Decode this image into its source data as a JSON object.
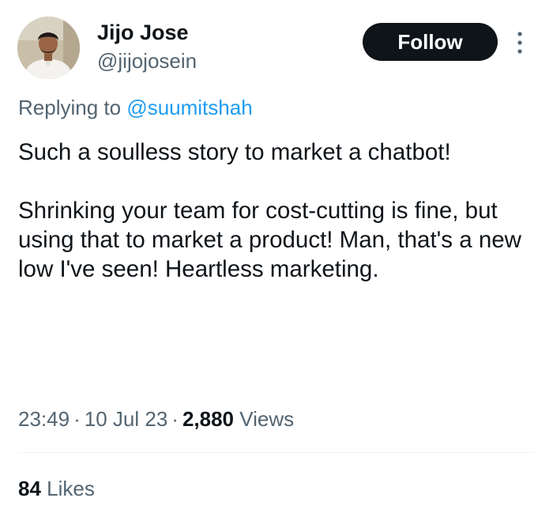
{
  "author": {
    "display_name": "Jijo Jose",
    "handle": "@jijojosein"
  },
  "follow_button": {
    "label": "Follow"
  },
  "reply": {
    "prefix": "Replying to ",
    "mention": "@suumitshah"
  },
  "tweet": {
    "paragraphs": [
      "Such a soulless story to market a chatbot!",
      "Shrinking your team for cost-cutting is fine, but using that to market a product! Man, that's a new low I've seen! Heartless marketing."
    ]
  },
  "meta": {
    "time": "23:49",
    "separator": "·",
    "date": "10 Jul 23",
    "views_count": "2,880",
    "views_label": "Views"
  },
  "engagement": {
    "likes_count": "84",
    "likes_label": "Likes"
  },
  "icons": {
    "more": "more-vertical-icon"
  },
  "colors": {
    "text_primary": "#0f1419",
    "text_secondary": "#536471",
    "link": "#1d9bf0",
    "button_bg": "#0f1419",
    "button_text": "#ffffff",
    "divider": "#eff3f4"
  }
}
